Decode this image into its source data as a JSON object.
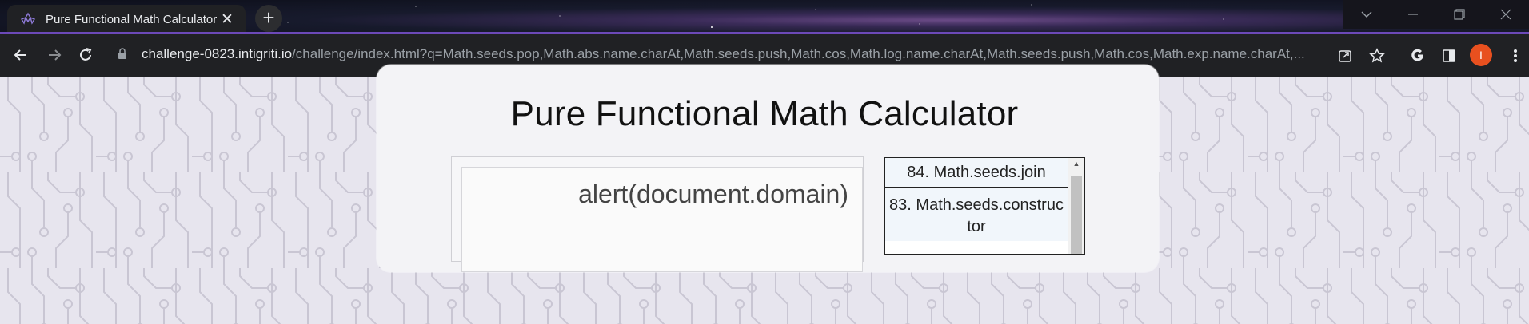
{
  "browser": {
    "tab": {
      "title": "Pure Functional Math Calculator",
      "close_glyph": "✕",
      "favicon": "intigriti-logo-icon"
    },
    "new_tab_glyph": "+",
    "window_controls": [
      "chevron-down-icon",
      "minimize-icon",
      "restore-icon",
      "close-icon"
    ],
    "address": {
      "host": "challenge-0823.intigriti.io",
      "path": "/challenge/index.html?q=Math.seeds.pop,Math.abs.name.charAt,Math.seeds.push,Math.cos,Math.log.name.charAt,Math.seeds.push,Math.cos,Math.exp.name.charAt,..."
    },
    "profile_initial": "I",
    "colors": {
      "tab_bg": "#202124",
      "toolbar_bg": "#202124",
      "accent": "#6c49b8",
      "avatar": "#e8501f"
    }
  },
  "page": {
    "title": "Pure Functional Math Calculator",
    "display": {
      "expression": "alert(document.domain)"
    },
    "history": [
      {
        "label": "84. Math.seeds.join"
      },
      {
        "label": "83. Math.seeds.constructor"
      }
    ],
    "colors": {
      "background": "#e7e5ee",
      "card": "#f3f3f6",
      "history_item_bg": "#f1f6fb"
    }
  }
}
